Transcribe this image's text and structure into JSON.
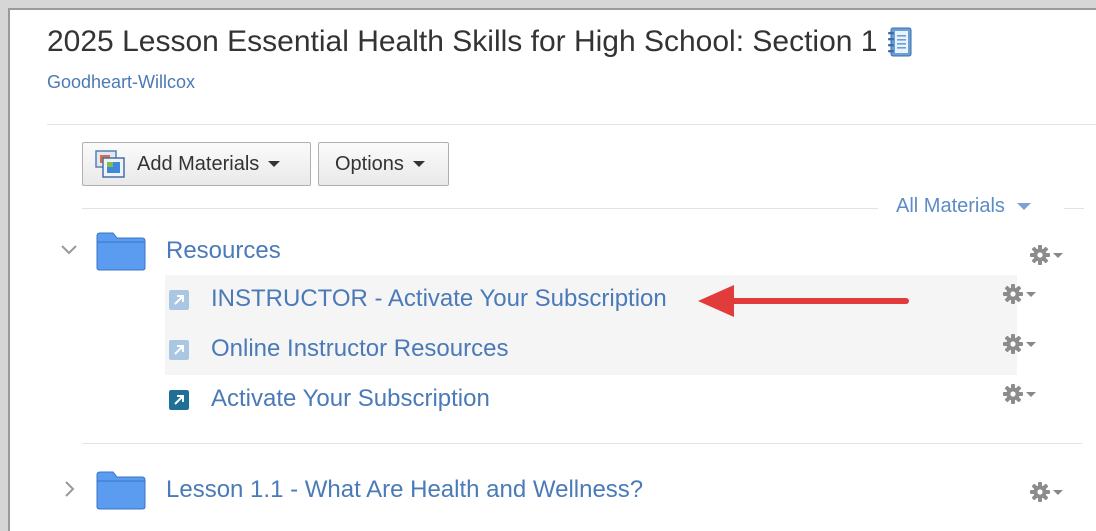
{
  "page": {
    "title": "2025 Lesson Essential Health Skills for High School: Section 1",
    "publisher": "Goodheart-Willcox"
  },
  "toolbar": {
    "add_materials_label": "Add Materials",
    "options_label": "Options"
  },
  "filter": {
    "label": "All Materials"
  },
  "folders": [
    {
      "title": "Resources",
      "expanded": true,
      "items": [
        {
          "title": "INSTRUCTOR - Activate Your Subscription",
          "icon": "external-link-icon-light",
          "highlighted": true
        },
        {
          "title": "Online Instructor Resources",
          "icon": "external-link-icon-light",
          "highlighted": true
        },
        {
          "title": "Activate Your Subscription",
          "icon": "external-link-icon-dark",
          "highlighted": false
        }
      ]
    },
    {
      "title": "Lesson 1.1 - What Are Health and Wellness?",
      "expanded": false,
      "items": []
    }
  ],
  "colors": {
    "link": "#4a7ab8",
    "folder": "#5b9bf0",
    "annotation_arrow": "#e23b3b",
    "link_icon_light": "#a9c6e2",
    "link_icon_dark": "#1f6f96"
  }
}
